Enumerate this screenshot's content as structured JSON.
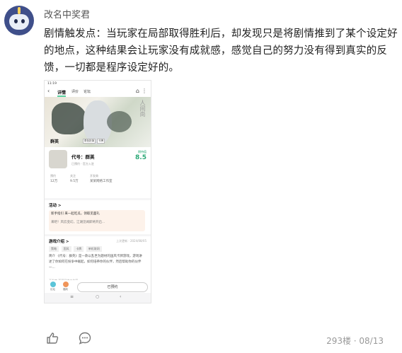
{
  "post": {
    "username": "改名中奖君",
    "text": "剧情触发点：当玩家在局部取得胜利后，却发现只是将剧情推到了某个设定好的地点，这种结果会让玩家没有成就感，感觉自己的努力没有得到真实的反馈，一切都是程序设定好的。",
    "floor": "293楼 · 08/13"
  },
  "screenshot": {
    "time": "11:19",
    "tabs": [
      "详情",
      "评价",
      "论坛"
    ],
    "banner_title": "群英",
    "banner_tags": [
      "角色扮演",
      "卡牌"
    ],
    "banner_ink": "人间尚",
    "game_name": "代号：群英",
    "game_sub": "已预约 · 官方入驻",
    "score_label": "期待值",
    "score": "8.5",
    "meta_labels": [
      "预约",
      "关注",
      "开发商"
    ],
    "meta_values": [
      "12万",
      "9.5万",
      "某某网络工作室"
    ],
    "activity_head": "活动 >",
    "activity_line1": "新手指引 来一起吃瓜，领取见面礼",
    "activity_line2": "来吧！风云变幻，江湖见闻即将开启...",
    "intro_head": "游戏介绍 >",
    "intro_date": "上次更新 · 2024/08/05",
    "intro_tags": [
      "策略",
      "国风",
      "卡牌",
      "单机联网"
    ],
    "intro_desc": "简介 《代号：群英》是一款以乱世为题材的国风卡牌游戏，游戏讲述了你如何在纷争中崛起，如何培养你的伙伴，然后帮助你的伙伴一...",
    "developer": "开发商 某某网络工作室",
    "bottom_labels": [
      "论坛",
      "福利"
    ],
    "cta": "已预约",
    "sysnav": [
      "≡",
      "○",
      "‹"
    ]
  },
  "footer": {
    "like_icon": "thumbs-up-icon",
    "comment_icon": "comment-bubble-icon"
  }
}
